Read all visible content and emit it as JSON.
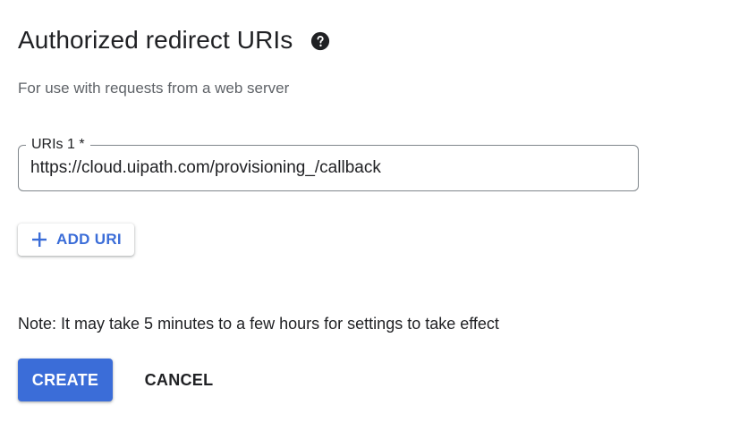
{
  "section": {
    "title": "Authorized redirect URIs",
    "help_icon": "help-circle-icon",
    "subtitle": "For use with requests from a web server"
  },
  "uri_field": {
    "label": "URIs 1 *",
    "value": "https://cloud.uipath.com/provisioning_/callback"
  },
  "add_uri": {
    "icon": "plus-icon",
    "label": "ADD URI"
  },
  "note": "Note: It may take 5 minutes to a few hours for settings to take effect",
  "actions": {
    "create_label": "CREATE",
    "cancel_label": "CANCEL"
  },
  "colors": {
    "primary": "#3b6dd8",
    "text": "#202124",
    "secondary_text": "#5f6368",
    "border": "#80868b"
  }
}
